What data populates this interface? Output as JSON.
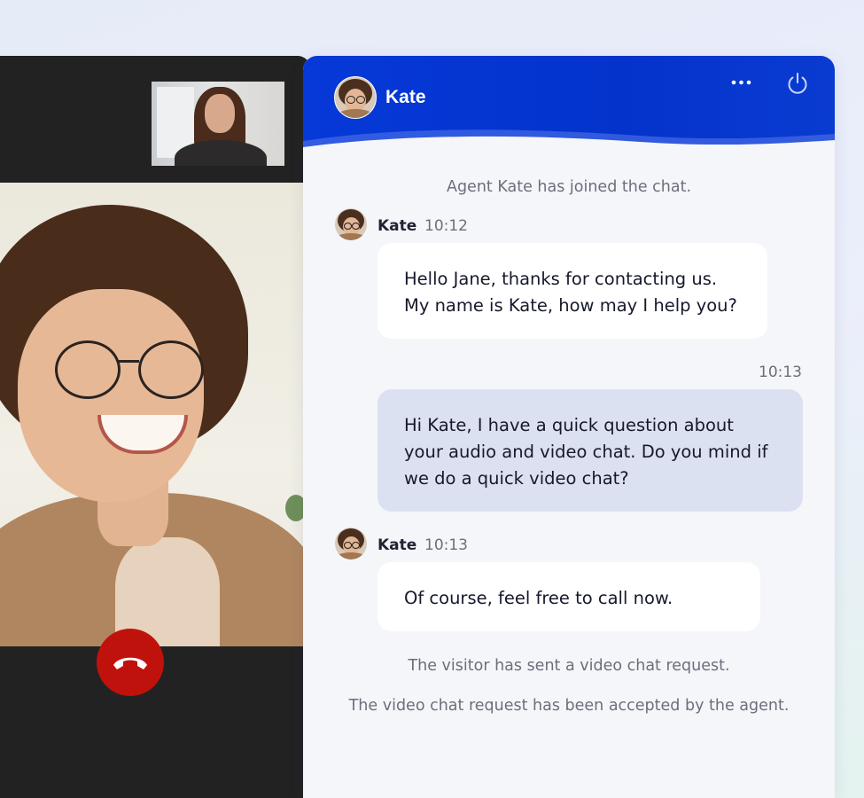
{
  "header": {
    "agent_name": "Kate",
    "more_icon": "more-horizontal-icon",
    "power_icon": "power-icon",
    "colors": {
      "header_blue": "#0639d8",
      "end_call_red": "#c0120c",
      "visitor_bubble": "#dce1f2"
    }
  },
  "video": {
    "end_call_icon": "phone-hangup-icon"
  },
  "messages": {
    "system_joined": "Agent Kate has joined the chat.",
    "msg1": {
      "sender": "Kate",
      "time": "10:12",
      "lines": [
        "Hello Jane, thanks for contacting us.",
        "My name is Kate, how may I help you?"
      ]
    },
    "msg2": {
      "time": "10:13",
      "lines": [
        "Hi Kate, I have a quick question about",
        "your audio and video chat. Do you mind if",
        "we do a quick video chat?"
      ]
    },
    "msg3": {
      "sender": "Kate",
      "time": "10:13",
      "lines": [
        "Of course, feel free to call now."
      ]
    },
    "system_request": "The visitor has sent a video chat request.",
    "system_accepted": "The video chat request has been accepted by the agent."
  }
}
